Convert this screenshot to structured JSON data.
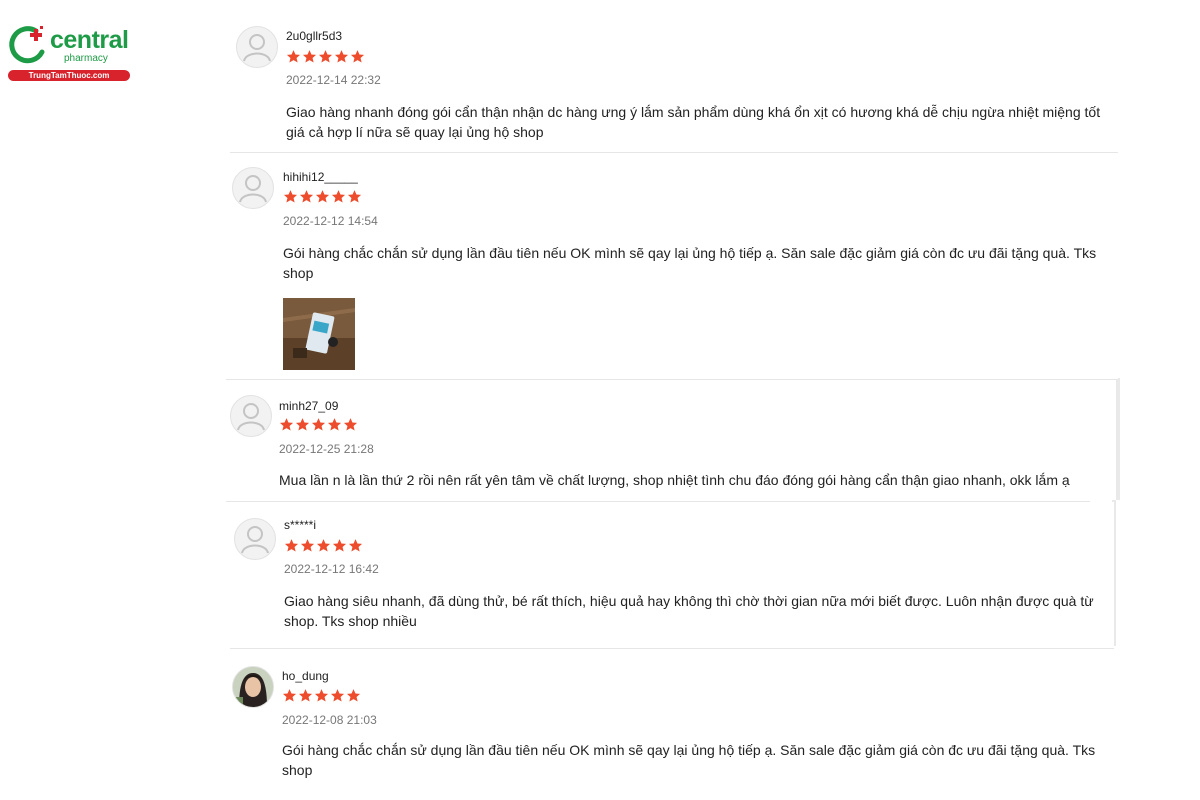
{
  "brand": {
    "name": "central",
    "sub": "pharmacy",
    "site": "TrungTamThuoc.com",
    "colors": {
      "green": "#1e9b46",
      "red": "#d8222c",
      "star": "#ee4d2d"
    }
  },
  "reviews": [
    {
      "username": "2u0gllr5d3",
      "rating": 5,
      "date": "2022-12-14 22:32",
      "comment": "Giao hàng nhanh đóng gói cẩn thận nhận dc hàng ưng ý lắm sản phẩm dùng khá ổn xịt có hương khá dễ chịu ngừa nhiệt miệng tốt giá cả hợp lí nữa sẽ quay lại ủng hộ shop",
      "avatar": "default-user-icon"
    },
    {
      "username": "hihihi12_____",
      "rating": 5,
      "date": "2022-12-12 14:54",
      "comment": "Gói hàng chắc chắn sử dụng lần đầu tiên nếu OK mình sẽ qay lại ủng hộ tiếp ạ. Săn sale đặc giảm giá còn đc ưu đãi tặng quà. Tks shop",
      "avatar": "default-user-icon",
      "has_photo": true
    },
    {
      "username": "minh27_09",
      "rating": 5,
      "date": "2022-12-25 21:28",
      "comment": "Mua lần n là lần thứ 2 rồi nên rất yên tâm về chất lượng, shop nhiệt tình chu đáo đóng gói hàng cẩn thận giao nhanh, okk lắm ạ",
      "avatar": "default-user-icon"
    },
    {
      "username": "s*****i",
      "rating": 5,
      "date": "2022-12-12 16:42",
      "comment": "Giao hàng siêu nhanh, đã dùng thử, bé rất thích, hiệu quả hay không thì chờ thời gian nữa mới biết được. Luôn nhận được quà từ shop. Tks shop nhiều",
      "avatar": "default-user-icon"
    },
    {
      "username": "ho_dung",
      "rating": 5,
      "date": "2022-12-08 21:03",
      "comment": "Gói hàng chắc chắn sử dụng lần đầu tiên nếu OK mình sẽ qay lại ủng hộ tiếp ạ. Săn sale đặc giảm giá còn đc ưu đãi tặng quà. Tks shop",
      "avatar": "profile-photo"
    }
  ]
}
